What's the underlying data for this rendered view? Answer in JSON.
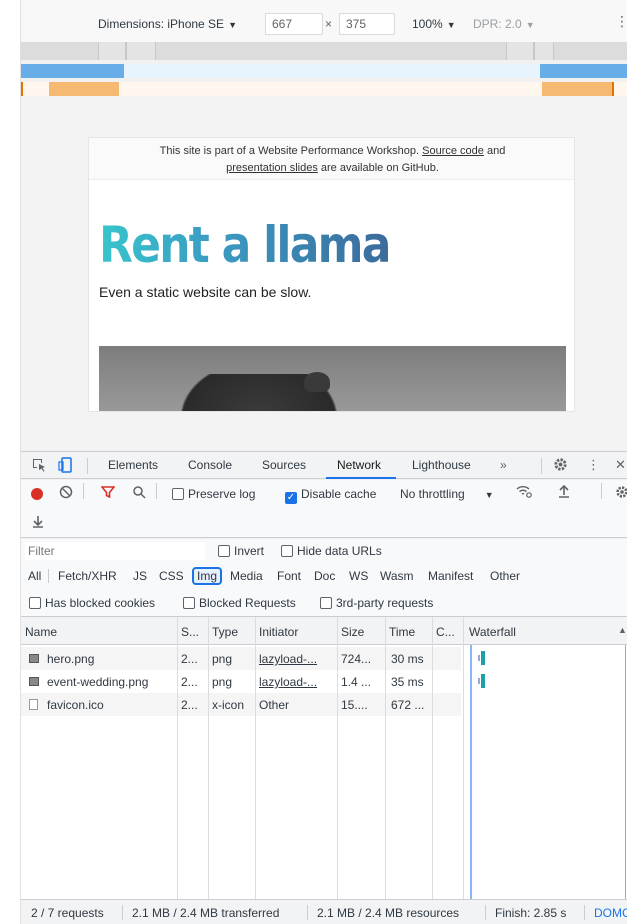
{
  "device_toolbar": {
    "dimensions_label": "Dimensions: iPhone SE",
    "width_value": "667",
    "times": "×",
    "height_value": "375",
    "zoom": "100%",
    "dpr": "DPR: 2.0"
  },
  "site": {
    "banner_text_1": "This site is part of a Website Performance Workshop.",
    "banner_link_1": "Source code",
    "banner_text_2": "and",
    "banner_link_2": "presentation slides",
    "banner_text_3": "are available on GitHub.",
    "hero_title": "Rent a llama",
    "hero_subtitle": "Even a static website can be slow."
  },
  "devtools_tabs": [
    "Elements",
    "Console",
    "Sources",
    "Network",
    "Lighthouse"
  ],
  "devtools_active_tab": "Network",
  "devtools_more": "»",
  "network_toolbar": {
    "preserve_log": "Preserve log",
    "disable_cache": "Disable cache",
    "throttling": "No throttling"
  },
  "filter": {
    "placeholder": "Filter",
    "invert": "Invert",
    "hide_data_urls": "Hide data URLs",
    "types": [
      "All",
      "Fetch/XHR",
      "JS",
      "CSS",
      "Img",
      "Media",
      "Font",
      "Doc",
      "WS",
      "Wasm",
      "Manifest",
      "Other"
    ],
    "selected_type": "Img",
    "has_blocked_cookies": "Has blocked cookies",
    "blocked_requests": "Blocked Requests",
    "third_party": "3rd-party requests"
  },
  "table": {
    "columns": [
      "Name",
      "S...",
      "Type",
      "Initiator",
      "Size",
      "Time",
      "C...",
      "Waterfall"
    ],
    "rows": [
      {
        "name": "hero.png",
        "status": "2...",
        "type": "png",
        "initiator": "lazyload-...",
        "size": "724...",
        "time": "30 ms"
      },
      {
        "name": "event-wedding.png",
        "status": "2...",
        "type": "png",
        "initiator": "lazyload-...",
        "size": "1.4 ...",
        "time": "35 ms"
      },
      {
        "name": "favicon.ico",
        "status": "2...",
        "type": "x-icon",
        "initiator": "Other",
        "size": "15....",
        "time": "672 ..."
      }
    ]
  },
  "status_bar": {
    "requests": "2 / 7 requests",
    "transferred": "2.1 MB / 2.4 MB transferred",
    "resources": "2.1 MB / 2.4 MB resources",
    "finish": "Finish: 2.85 s",
    "dom": "DOMC"
  },
  "colors": {
    "accent": "#1a73e8",
    "record": "#d93025",
    "filter_icon": "#d93025",
    "waterfall_bar": "#1da1a9"
  }
}
